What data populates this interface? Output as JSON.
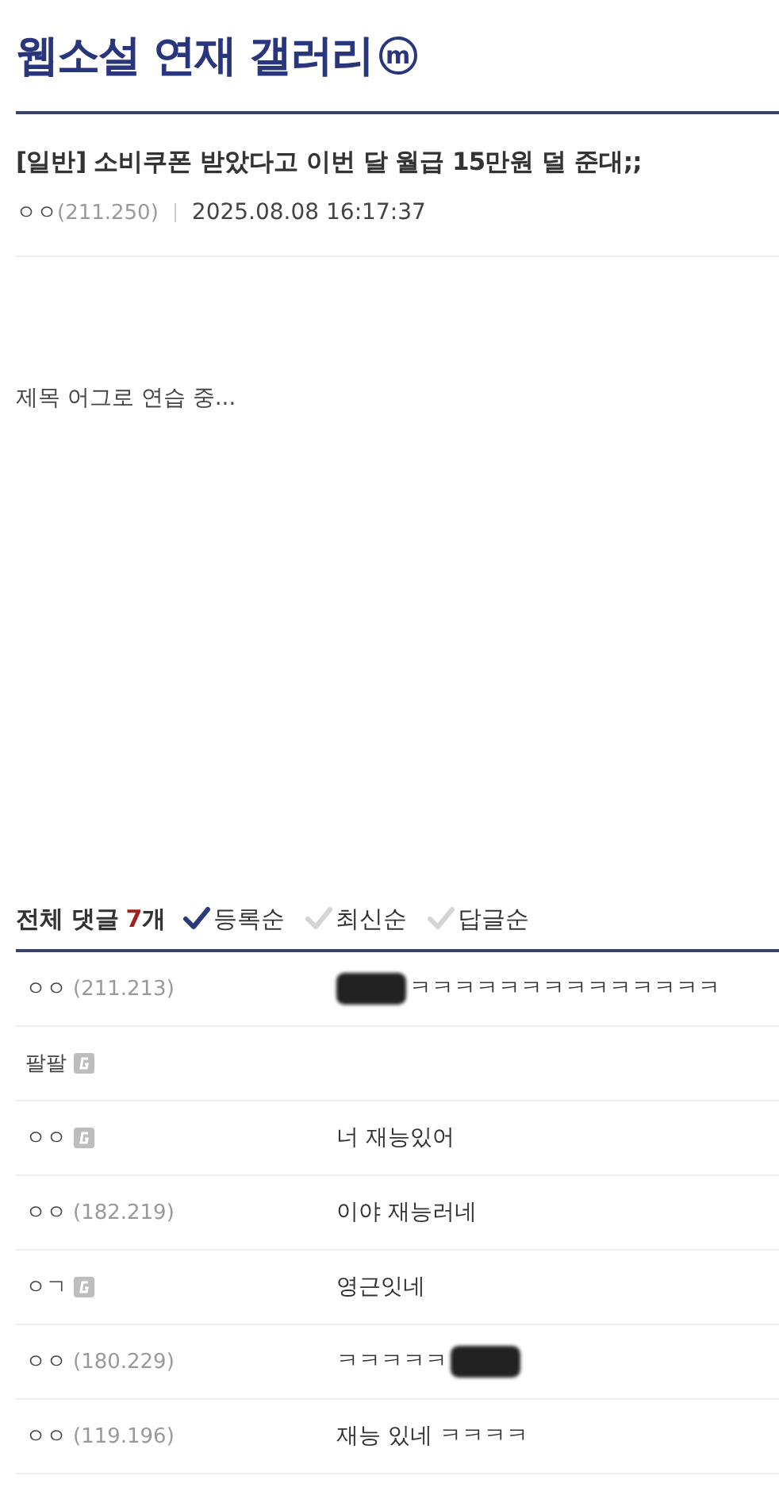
{
  "gallery": {
    "title": "웹소설 연재 갤러리",
    "badge": "m"
  },
  "post": {
    "title": "[일반] 소비쿠폰 받았다고 이번 달 월급 15만원 덜 준대;;",
    "author": "ㅇㅇ",
    "ip": "(211.250)",
    "date": "2025.08.08 16:17:37",
    "body": "제목 어그로 연습 중..."
  },
  "comments_header": {
    "label": "전체 댓글",
    "count": "7",
    "unit": "개",
    "sorts": [
      {
        "label": "등록순",
        "selected": true
      },
      {
        "label": "최신순",
        "selected": false
      },
      {
        "label": "답글순",
        "selected": false
      }
    ]
  },
  "comments": [
    {
      "author": "ㅇㅇ",
      "ip": "(211.213)",
      "member": false,
      "censored_start": true,
      "text": "ㅋㅋㅋㅋㅋㅋㅋㅋㅋㅋㅋㅋㅋㅋ"
    },
    {
      "author": "팔팔",
      "member": true
    },
    {
      "author": "ㅇㅇ",
      "member": true,
      "text": "너 재능있어"
    },
    {
      "author": "ㅇㅇ",
      "ip": "(182.219)",
      "member": false,
      "text": "이야 재능러네"
    },
    {
      "author": "ㅇㄱ",
      "member": true,
      "text": "영근잇네"
    },
    {
      "author": "ㅇㅇ",
      "ip": "(180.229)",
      "member": false,
      "censored_end": true,
      "text": "ㅋㅋㅋㅋㅋ"
    },
    {
      "author": "ㅇㅇ",
      "ip": "(119.196)",
      "member": false,
      "text": "재능 있네 ㅋㅋㅋㅋ"
    }
  ]
}
